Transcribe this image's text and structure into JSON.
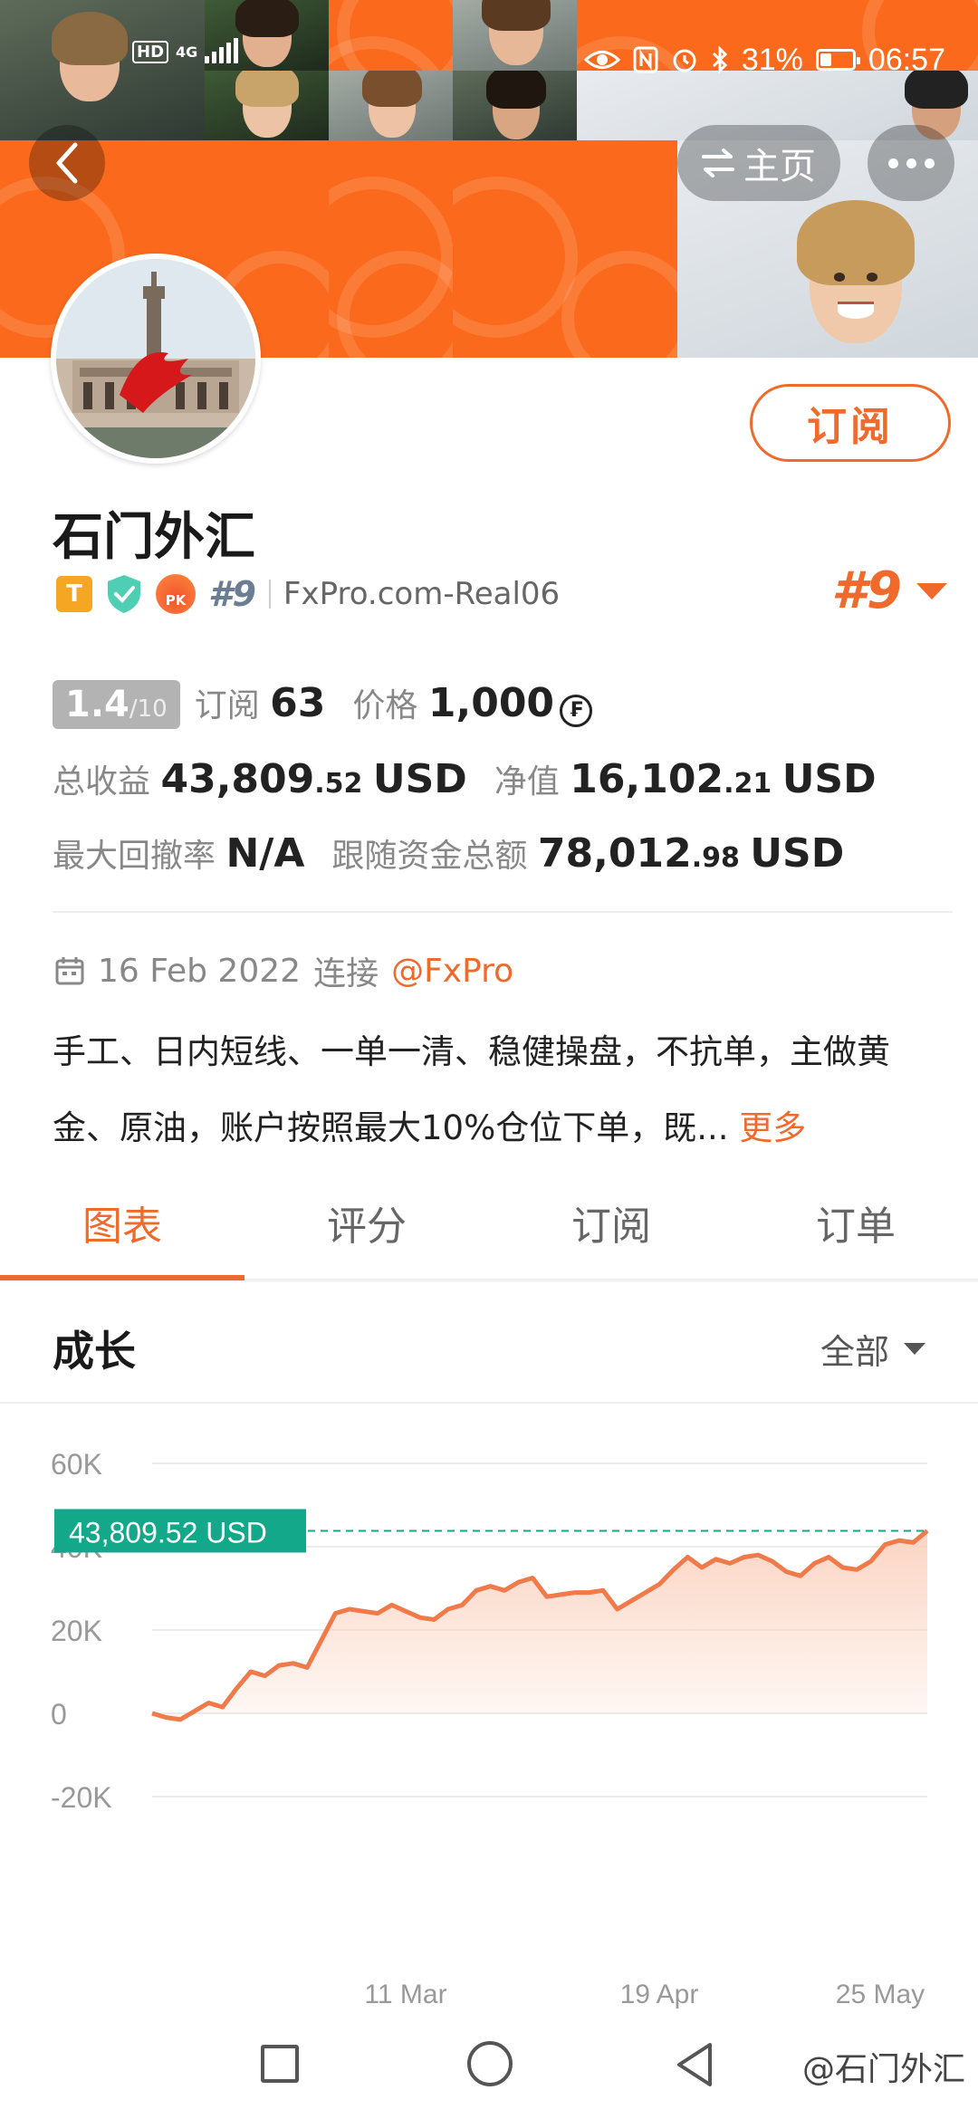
{
  "status_bar": {
    "net_left": "HD",
    "net_gen": "4G",
    "battery": "31%",
    "battery_level": 0.31,
    "time": "06:57"
  },
  "header": {
    "back_icon": "chevron-left-icon",
    "home_label": "主页",
    "home_icon": "swap-icon",
    "more_icon": "more-dots-icon"
  },
  "profile": {
    "name": "石门外汇",
    "subscribe_label": "订阅",
    "badge_t": "T",
    "badge_pk": "PK",
    "rank_small": "#9",
    "broker": "FxPro.com-Real06",
    "rank_big": "#9"
  },
  "stats": {
    "score": "1.4",
    "score_max": "/10",
    "subs_label": "订阅",
    "subs_value": "63",
    "price_label": "价格",
    "price_value": "1,000",
    "coin_icon": "currency-coin-icon",
    "profit_label": "总收益",
    "profit_int": "43,809",
    "profit_dec": ".52",
    "profit_unit": "USD",
    "equity_label": "净值",
    "equity_int": "16,102",
    "equity_dec": ".21",
    "equity_unit": "USD",
    "drawdown_label": "最大回撤率",
    "drawdown_value": "N/A",
    "follow_label": "跟随资金总额",
    "follow_int": "78,012",
    "follow_dec": ".98",
    "follow_unit": "USD"
  },
  "connection": {
    "date": "16 Feb 2022",
    "connect_label": "连接",
    "provider": "@FxPro"
  },
  "description": {
    "text": "手工、日内短线、一单一清、稳健操盘，不抗单，主做黄金、原油，账户按照最大10%仓位下单，既...",
    "more_label": "更多"
  },
  "tabs": [
    {
      "label": "图表",
      "active": true
    },
    {
      "label": "评分",
      "active": false
    },
    {
      "label": "订阅",
      "active": false
    },
    {
      "label": "订单",
      "active": false
    }
  ],
  "section": {
    "title": "成长",
    "range_label": "全部"
  },
  "chart_data": {
    "type": "area",
    "title": "",
    "xlabel": "",
    "ylabel": "",
    "ylim": [
      -20000,
      60000
    ],
    "yticks": [
      "60K",
      "40K",
      "20K",
      "0",
      "-20K"
    ],
    "ytick_values": [
      60000,
      40000,
      20000,
      0,
      -20000
    ],
    "xticks": [
      "11 Mar",
      "19 Apr",
      "25 May"
    ],
    "current_label": "43,809.52 USD",
    "current_value": 43809.52,
    "grid": true,
    "line_color": "#f07a4a",
    "fill_color": "#fbd2c0",
    "label_color": "#13a889",
    "values": [
      0,
      -1000,
      -1500,
      500,
      2500,
      1500,
      6000,
      10000,
      9000,
      11500,
      12000,
      11000,
      17500,
      24000,
      25000,
      24500,
      24000,
      26000,
      24500,
      23000,
      22500,
      25000,
      26000,
      29500,
      30500,
      29500,
      31500,
      32500,
      28000,
      28500,
      29000,
      29000,
      29500,
      25000,
      27000,
      29000,
      31000,
      34500,
      37500,
      35000,
      37000,
      36000,
      37500,
      38000,
      36500,
      34000,
      33000,
      36000,
      37500,
      35000,
      34500,
      36500,
      40500,
      41500,
      41000,
      43809.52
    ]
  },
  "navbar": {
    "recent_icon": "square-icon",
    "home_icon": "circle-icon",
    "back_icon": "triangle-back-icon",
    "watermark": "@石门外汇"
  }
}
